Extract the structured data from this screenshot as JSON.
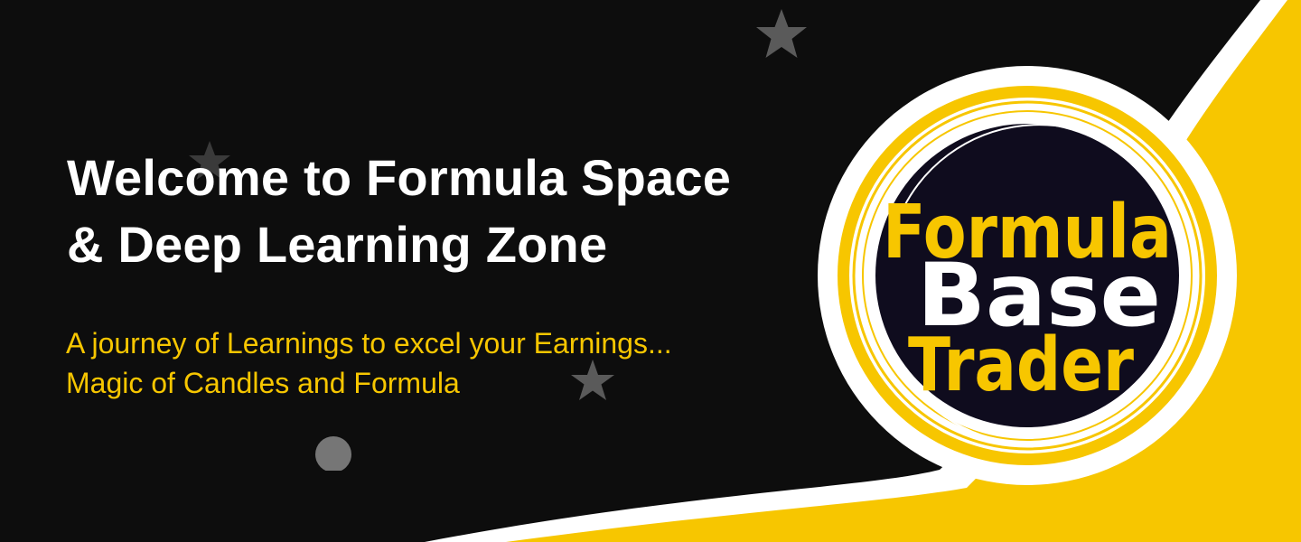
{
  "banner": {
    "headline_line1": "Welcome to Formula Space",
    "headline_line2": "& Deep Learning Zone",
    "tagline_line1": "A journey of Learnings to excel your Earnings...",
    "tagline_line2": "Magic of Candles and Formula"
  },
  "logo": {
    "word1": "Formula",
    "word2": "Base",
    "word3": "Trader"
  },
  "colors": {
    "background": "#0d0d0d",
    "accent_yellow": "#f7c600",
    "logo_dark": "#0f0c1e",
    "headline": "#ffffff",
    "tagline": "#f7c600",
    "star": "#5a5a5a"
  },
  "icons": [
    "star-icon",
    "circle-dot"
  ]
}
